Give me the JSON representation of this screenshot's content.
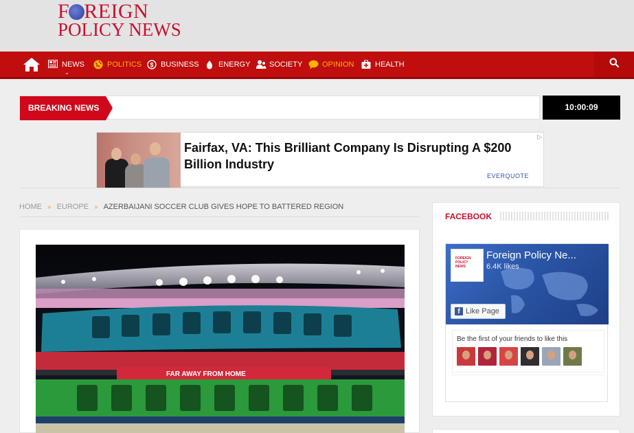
{
  "site": {
    "logo_line1_pre": "F",
    "logo_line1_post": "REIGN",
    "logo_line2": "POLICY NEWS"
  },
  "nav": {
    "items": [
      {
        "label": "NEWS",
        "icon": "newspaper-icon"
      },
      {
        "label": "POLITICS",
        "icon": "globe-icon",
        "active": true
      },
      {
        "label": "BUSINESS",
        "icon": "dollar-icon"
      },
      {
        "label": "ENERGY",
        "icon": "drop-icon"
      },
      {
        "label": "SOCIETY",
        "icon": "people-icon"
      },
      {
        "label": "OPINION",
        "icon": "speech-bubble-icon",
        "active": true
      },
      {
        "label": "HEALTH",
        "icon": "medkit-icon"
      }
    ],
    "colors": {
      "bar": "#c00d0d",
      "active": "#ffb400"
    }
  },
  "breaking": {
    "label": "BREAKING NEWS",
    "time": "10:00:09"
  },
  "ad": {
    "headline": "Fairfax, VA: This Brilliant Company Is Disrupting A $200 Billion Industry",
    "brand": "EVERQUOTE",
    "choices_icon": "adchoices-icon"
  },
  "breadcrumb": {
    "items": [
      "HOME",
      "EUROPE"
    ],
    "current": "AZERBAIJANI SOCCER CLUB GIVES HOPE TO BATTERED REGION"
  },
  "article": {
    "photo_banner": "FAR AWAY FROM HOME"
  },
  "sidebar": {
    "facebook": {
      "title": "FACEBOOK",
      "page_name": "Foreign Policy Ne...",
      "likes": "6.4K likes",
      "like_button": "Like Page",
      "friends_text": "Be the first of your friends to like this"
    }
  }
}
